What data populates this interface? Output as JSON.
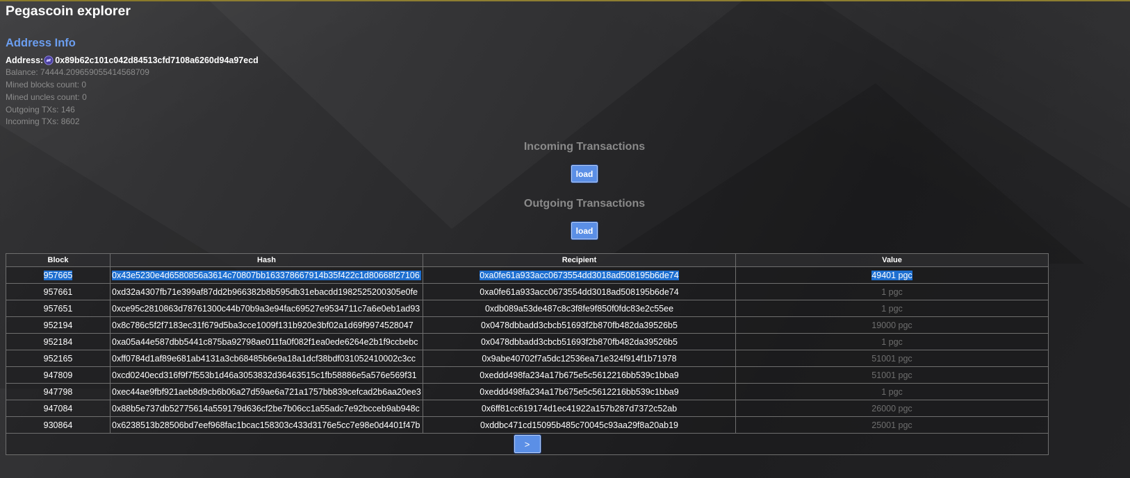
{
  "app_title": "Pegascoin explorer",
  "section_heading": "Address Info",
  "address": {
    "label": "Address:",
    "icon": "pegascoin-logo-icon",
    "value": "0x89b62c101c042d84513cfd7108a6260d94a97ecd"
  },
  "info": {
    "balance": "Balance: 74444.209659055414568709",
    "mined_blocks": "Mined blocks count: 0",
    "mined_uncles": "Mined uncles count: 0",
    "outgoing_txs": "Outgoing TXs: 146",
    "incoming_txs": "Incoming TXs: 8602"
  },
  "incoming": {
    "heading": "Incoming Transactions",
    "load_label": "load"
  },
  "outgoing": {
    "heading": "Outgoing Transactions",
    "load_label": "load"
  },
  "table": {
    "headers": [
      "Block",
      "Hash",
      "Recipient",
      "Value"
    ],
    "rows": [
      {
        "block": "957665",
        "hash": "0x43e5230e4d6580856a3614c70807bb163378667914b35f422c1d80668f27106",
        "recipient": "0xa0fe61a933acc0673554dd3018ad508195b6de74",
        "value": "49401 pgc"
      },
      {
        "block": "957661",
        "hash": "0xd32a4307fb71e399af87dd2b966382b8b595db31ebacdd1982525200305e0fe",
        "recipient": "0xa0fe61a933acc0673554dd3018ad508195b6de74",
        "value": "1 pgc"
      },
      {
        "block": "957651",
        "hash": "0xce95c2810863d78761300c44b70b9a3e94fac69527e9534711c7a6e0eb1ad93",
        "recipient": "0xdb089a53de487c8c3f8fe9f850f0fdc83e2c55ee",
        "value": "1 pgc"
      },
      {
        "block": "952194",
        "hash": " 0x8c786c5f2f7183ec31f679d5ba3cce1009f131b920e3bf02a1d69f9974528047",
        "recipient": "0x0478dbbadd3cbcb51693f2b870fb482da39526b5",
        "value": "19000 pgc"
      },
      {
        "block": "952184",
        "hash": "0xa05a44e587dbb5441c875ba92798ae011fa0f082f1ea0ede6264e2b1f9ccbebc",
        "recipient": "0x0478dbbadd3cbcb51693f2b870fb482da39526b5",
        "value": "1 pgc"
      },
      {
        "block": "952165",
        "hash": "0xff0784d1af89e681ab4131a3cb68485b6e9a18a1dcf38bdf031052410002c3cc",
        "recipient": "0x9abe40702f7a5dc12536ea71e324f914f1b71978",
        "value": "51001 pgc"
      },
      {
        "block": "947809",
        "hash": "0xcd0240ecd316f9f7f553b1d46a3053832d36463515c1fb58886e5a576e569f31",
        "recipient": "0xeddd498fa234a17b675e5c5612216bb539c1bba9",
        "value": "51001 pgc"
      },
      {
        "block": "947798",
        "hash": "0xec44ae9fbf921aeb8d9cb6b06a27d59ae6a721a1757bb839cefcad2b6aa20ee3",
        "recipient": "0xeddd498fa234a17b675e5c5612216bb539c1bba9",
        "value": "1 pgc"
      },
      {
        "block": "947084",
        "hash": "0x88b5e737db52775614a559179d636cf2be7b06cc1a55adc7e92bcceb9ab948c",
        "recipient": "0x6ff81cc619174d1ec41922a157b287d7372c52ab",
        "value": "26000 pgc"
      },
      {
        "block": "930864",
        "hash": "0x6238513b28506bd7eef968fac1bcac158303c433d3176e5cc7e98e0d4401f47b",
        "recipient": "0xddbc471cd15095b485c70045c93aa29f8a20ab19",
        "value": "25001 pgc"
      }
    ],
    "next_label": ">"
  },
  "colors": {
    "accent": "#6b9ef0",
    "button": "#5b8fe6",
    "selection": "#1e6fd0",
    "muted_text": "#8c8c8c"
  }
}
